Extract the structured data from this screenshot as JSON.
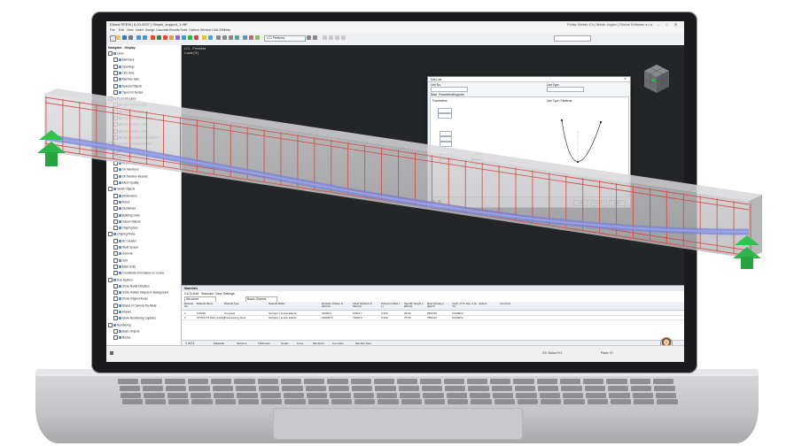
{
  "app": {
    "title": "Dlubal RFEM | 6.00.0037 | Simple_support_1.rf6*",
    "account": "Phillip Sieber-Ch | Marte Jaglov | Dlubal Software s.r.o."
  },
  "menu": [
    "File",
    "Edit",
    "View",
    "Insert",
    "Assign",
    "Calculate",
    "Results",
    "Tools",
    "Options",
    "Window",
    "CAD-BIM",
    "Help"
  ],
  "toolbar": {
    "load_case": "LC1",
    "load_case_name": "Prestress"
  },
  "navigator": {
    "title": "Navigator - Display",
    "items": [
      "Lines",
      "Members",
      "Openings",
      "Line Sets",
      "Member Sets",
      "Special Objects",
      "Types for Nodes",
      "Types for Lines",
      "Types for Members",
      "Display Topology on",
      "Free Rectangular Loads",
      "Free Circular Loads",
      "Free Polygon Loads",
      "Imposed Nodal Deformations",
      "Imposed Line Deformations",
      "Load Wizards",
      "Results",
      "Result Objects",
      "On Members",
      "On Member Results",
      "Mesh Quality",
      "Guide Objects",
      "Dimensions",
      "Notes",
      "Guidelines",
      "Building Grids",
      "Visual Objects",
      "Clipping Box",
      "Clipping Plane",
      "RC Header",
      "Weld Spacer",
      "General",
      "Grid",
      "Main Units",
      "Coordinate Information on Cursor",
      "Axis System",
      "Show Nodal Direction",
      "Show Hidden Objects in Background",
      "Show Clipped Areas",
      "Status of Camera Fly Mode",
      "Shears",
      "Show Numbering Captions",
      "Numbering",
      "Basic Objects",
      "Nodes"
    ]
  },
  "viewport": {
    "load_case": "LC1 - Prestress",
    "loads_label": "Loads [%]"
  },
  "materials": {
    "panel_title": "Materials",
    "menu": [
      "Go To",
      "Edit",
      "Selection",
      "View",
      "Settings"
    ],
    "filter_label": "Structure",
    "filter_value": "Basic Objects",
    "headers": [
      "Material No.",
      "Material Name",
      "Material Type",
      "Material Model",
      "Modulus of Elast. E [N/mm²]",
      "Shear Modulus G [N/mm²]",
      "Poisson's Ratio v [-]",
      "Specific Weight γ [kN/m³]",
      "Mass Density ρ [kg/m³]",
      "Coeff. of Th. Exp. α [1/°C]",
      "Options",
      "Comment"
    ],
    "rows": [
      [
        "1",
        "C25/30",
        "Concrete",
        "Isotropic | Linear Elastic",
        "31000.0",
        "12916.7",
        "0.200",
        "25.00",
        "2500.00",
        "0.000010",
        "",
        ""
      ],
      [
        "2",
        "1570/1770 Wire (Lobby)",
        "Prestressing Steel",
        "Isotropic | Linear Elastic",
        "195000.0",
        "75000.0",
        "0.300",
        "78.50",
        "7850.00",
        "0.000010",
        "",
        ""
      ]
    ],
    "pager": "1 of 11",
    "tabs": [
      "Materials",
      "Sections",
      "Thickness",
      "Nodes",
      "Lines",
      "Members",
      "Line Sets",
      "Member Sets"
    ]
  },
  "dialog": {
    "title": "Edit Line",
    "field1_label": "Line No.",
    "field2_label": "Line Type",
    "tabs": [
      "Base",
      "Parameters",
      "Supports"
    ],
    "section_label": "Parameters",
    "chart_label": "Line Type: Parabola",
    "buttons": [
      "OK",
      "Cancel",
      "Apply"
    ]
  },
  "status": {
    "coordinate_system": "CS: Global XYZ",
    "plane": "Plane: XY"
  },
  "colors": {
    "beam_fill": "#c4c4c6",
    "rebar": "#d1433c",
    "tendon": "#7a86d6",
    "support": "#2fb64a",
    "viewport_bg": "#242526"
  }
}
